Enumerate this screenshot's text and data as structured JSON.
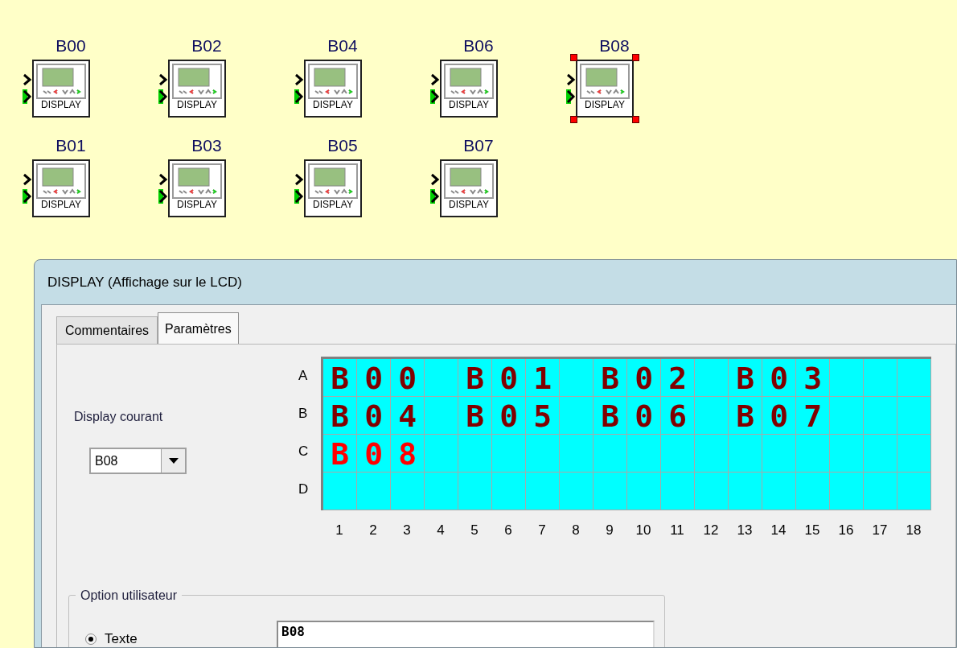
{
  "blocks": [
    {
      "label": "B00",
      "type": "DISPLAY",
      "selected": false
    },
    {
      "label": "B02",
      "type": "DISPLAY",
      "selected": false
    },
    {
      "label": "B04",
      "type": "DISPLAY",
      "selected": false
    },
    {
      "label": "B06",
      "type": "DISPLAY",
      "selected": false
    },
    {
      "label": "B08",
      "type": "DISPLAY",
      "selected": true
    },
    {
      "label": "B01",
      "type": "DISPLAY",
      "selected": false
    },
    {
      "label": "B03",
      "type": "DISPLAY",
      "selected": false
    },
    {
      "label": "B05",
      "type": "DISPLAY",
      "selected": false
    },
    {
      "label": "B07",
      "type": "DISPLAY",
      "selected": false
    }
  ],
  "dialog": {
    "title": "DISPLAY (Affichage sur le LCD)",
    "tabs": [
      {
        "label": "Commentaires",
        "selected": false
      },
      {
        "label": "Paramètres",
        "selected": true
      }
    ],
    "current_display": {
      "label": "Display courant",
      "value": "B08"
    },
    "lcd": {
      "rows": [
        {
          "label": "A",
          "texts": [
            "B00",
            "B01",
            "B02",
            "B03"
          ],
          "selected": false
        },
        {
          "label": "B",
          "texts": [
            "B04",
            "B05",
            "B06",
            "B07"
          ],
          "selected": false
        },
        {
          "label": "C",
          "texts": [
            "B08"
          ],
          "selected": true
        },
        {
          "label": "D"
        }
      ],
      "columns": [
        "1",
        "2",
        "3",
        "4",
        "5",
        "6",
        "7",
        "8",
        "9",
        "10",
        "11",
        "12",
        "13",
        "14",
        "15",
        "16",
        "17",
        "18"
      ]
    },
    "user_option": {
      "title": "Option utilisateur",
      "options": [
        {
          "label": "Texte",
          "selected": true
        }
      ],
      "value": "B08"
    }
  }
}
